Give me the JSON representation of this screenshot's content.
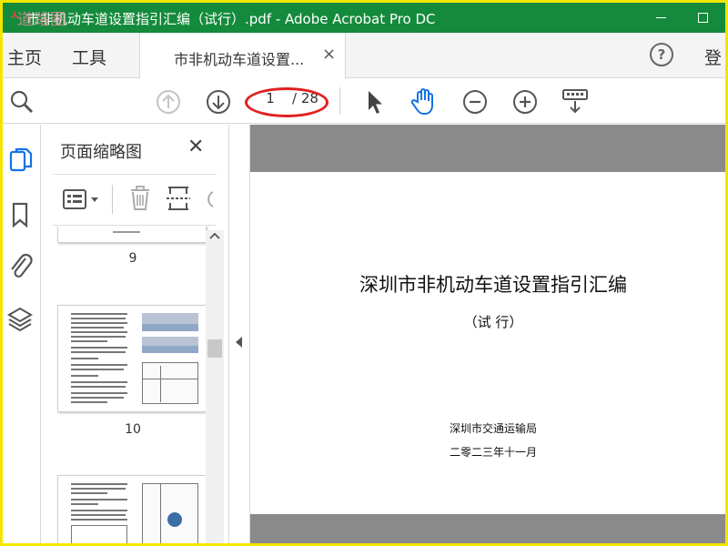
{
  "window": {
    "title": "市非机动车道设置指引汇编（试行）.pdf - Adobe Acrobat Pro DC",
    "app_icon": "acrobat-icon",
    "watermark": "道路圈"
  },
  "menu": {
    "home": "主页",
    "tools": "工具",
    "doc_tab": "市非机动车道设置...",
    "close_glyph": "×",
    "help_glyph": "?",
    "signin": "登"
  },
  "toolbar": {
    "current_page": "1",
    "total_pages": "/ 28",
    "icons": [
      "zoom-search-icon",
      "prev-page-icon",
      "next-page-icon",
      "select-cursor-icon",
      "hand-tool-icon",
      "zoom-out-icon",
      "zoom-in-icon",
      "page-display-icon"
    ]
  },
  "rail": {
    "icons": [
      "page-thumbnails-icon",
      "bookmark-icon",
      "attachment-icon",
      "layers-icon"
    ]
  },
  "thumbnails_panel": {
    "title": "页面缩略图",
    "close_glyph": "✕",
    "pages": [
      "9",
      "10"
    ]
  },
  "document": {
    "title": "深圳市非机动车道设置指引汇编",
    "subtitle": "（试  行）",
    "organization": "深圳市交通运输局",
    "date": "二零二三年十一月"
  },
  "colors": {
    "titlebar": "#148b3c",
    "frame": "#f2e600",
    "annotation_oval": "#e02020",
    "hand_tool": "#1473e6",
    "doc_background": "#8a8a8a"
  }
}
